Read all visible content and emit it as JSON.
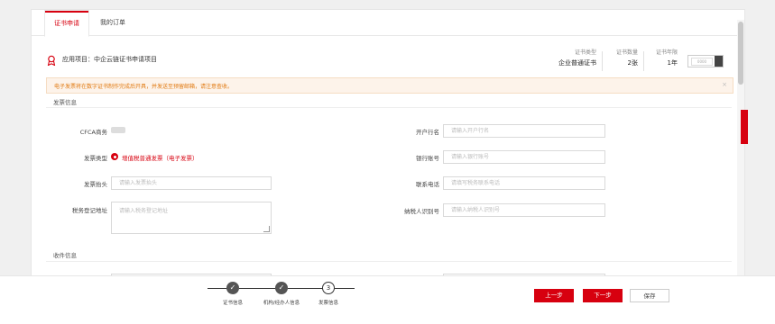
{
  "tabs": [
    {
      "label": "证书申请",
      "active": true
    },
    {
      "label": "我的订单",
      "active": false
    }
  ],
  "project": {
    "label": "应用项目：中企云链证书申请项目",
    "stats": [
      {
        "label": "证书类型",
        "value": "企业普通证书"
      },
      {
        "label": "证书数量",
        "value": "2张"
      },
      {
        "label": "证书年限",
        "value": "1年"
      }
    ],
    "toggle_text": "0000"
  },
  "notice": {
    "text": "电子发票将在数字证书制作完成后开具，并发送至预留邮箱，请注意查收。",
    "close": "×"
  },
  "invoice_section": {
    "title": "发票信息",
    "left": {
      "cfca_label": "CFCA商务",
      "type_label": "发票类型",
      "type_value": "增值税普通发票（电子发票）",
      "header_label": "发票抬头",
      "header_placeholder": "请输入发票抬头",
      "tax_addr_label": "税务登记地址",
      "tax_addr_placeholder": "请输入税务登记地址"
    },
    "right": {
      "bank_label": "开户行名",
      "bank_placeholder": "请输入开户行名",
      "account_label": "银行账号",
      "account_placeholder": "请输入银行账号",
      "phone_label": "联系电话",
      "phone_placeholder": "请填写税务联系电话",
      "taxid_label": "纳税人识别号",
      "taxid_placeholder": "请输入纳税人识别号"
    }
  },
  "receiver_section": {
    "title": "收件信息"
  },
  "steps": [
    {
      "label": "证书信息",
      "icon": "check-icon",
      "done": true
    },
    {
      "label": "机构/经办人信息",
      "icon": "check-icon",
      "done": true
    },
    {
      "label": "发票信息",
      "number": "3",
      "done": false
    }
  ],
  "buttons": {
    "prev": "上一步",
    "next": "下一步",
    "save": "保存"
  },
  "colors": {
    "accent": "#d7000f",
    "notice": "#e0780f"
  }
}
